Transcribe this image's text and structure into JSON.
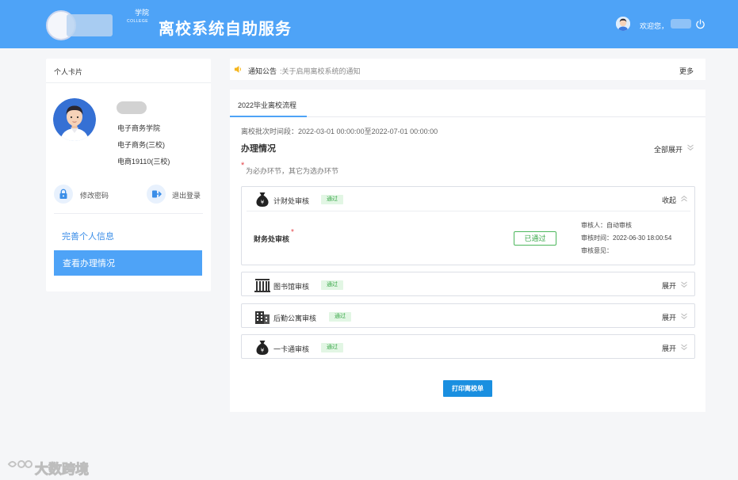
{
  "header": {
    "logo_cn": "学院",
    "logo_en": "COLLEGE",
    "title": "离校系统自助服务",
    "welcome": "欢迎您，"
  },
  "profile": {
    "card_title": "个人卡片",
    "college": "电子商务学院",
    "major": "电子商务(三校)",
    "class": "电商19110(三校)",
    "change_password": "修改密码",
    "logout": "退出登录",
    "menu": [
      {
        "label": "完善个人信息",
        "active": false
      },
      {
        "label": "查看办理情况",
        "active": true
      }
    ]
  },
  "notice": {
    "label": "通知公告",
    "text": ":关于启用离校系统的通知",
    "more": "更多"
  },
  "main": {
    "tab": "2022毕业离校流程",
    "period": "离校批次时间段：2022-03-01 00:00:00至2022-07-01 00:00:00",
    "section_title": "办理情况",
    "expand_all": "全部展开",
    "required_note": "为必办环节，其它为选办环节",
    "panels": [
      {
        "title": "计财处审核",
        "status": "通过",
        "toggle": "收起",
        "icon": "money-bag-icon",
        "expanded": true
      },
      {
        "title": "图书馆审核",
        "status": "通过",
        "toggle": "展开",
        "icon": "library-building-icon",
        "expanded": false
      },
      {
        "title": "后勤公寓审核",
        "status": "通过",
        "toggle": "展开",
        "icon": "apartment-building-icon",
        "expanded": false
      },
      {
        "title": "一卡通审核",
        "status": "通过",
        "toggle": "展开",
        "icon": "money-bag-icon",
        "expanded": false
      }
    ],
    "finance_detail": {
      "sub_title": "财务处审核",
      "passed": "已通过",
      "reviewer": "审核人：自动审核",
      "review_time": "审核时间：2022-06-30 18:00:54",
      "opinion": "审核意见："
    },
    "print_button": "打印离校单"
  },
  "watermark": {
    "text": "大数跨境"
  },
  "colors": {
    "header_bg": "#4ea3f7",
    "accent": "#4ea3f7",
    "link": "#3b8ee8",
    "pass_green": "#3aa84a",
    "pass_bg": "#e2f6e4",
    "required_red": "#e5484d",
    "print_btn": "#1a8fe0"
  }
}
